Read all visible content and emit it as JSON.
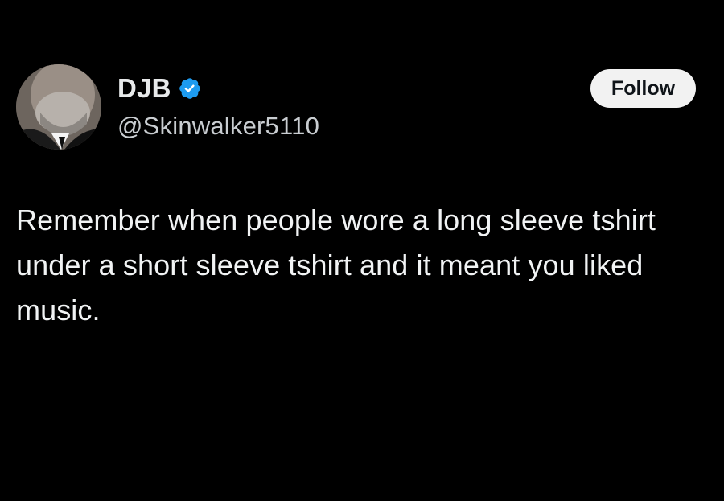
{
  "author": {
    "display_name": "DJB",
    "handle": "@Skinwalker5110",
    "verified": true,
    "verified_icon": "verified-badge-icon",
    "avatar_icon": "profile-avatar"
  },
  "actions": {
    "follow_label": "Follow"
  },
  "tweet": {
    "text": "Remember when people wore a long sleeve tshirt under a short sleeve tshirt and it meant you liked music."
  },
  "colors": {
    "background": "#000000",
    "text": "#e7e9ea",
    "verified_blue": "#1d9bf0",
    "follow_bg": "#f2f2f2"
  }
}
